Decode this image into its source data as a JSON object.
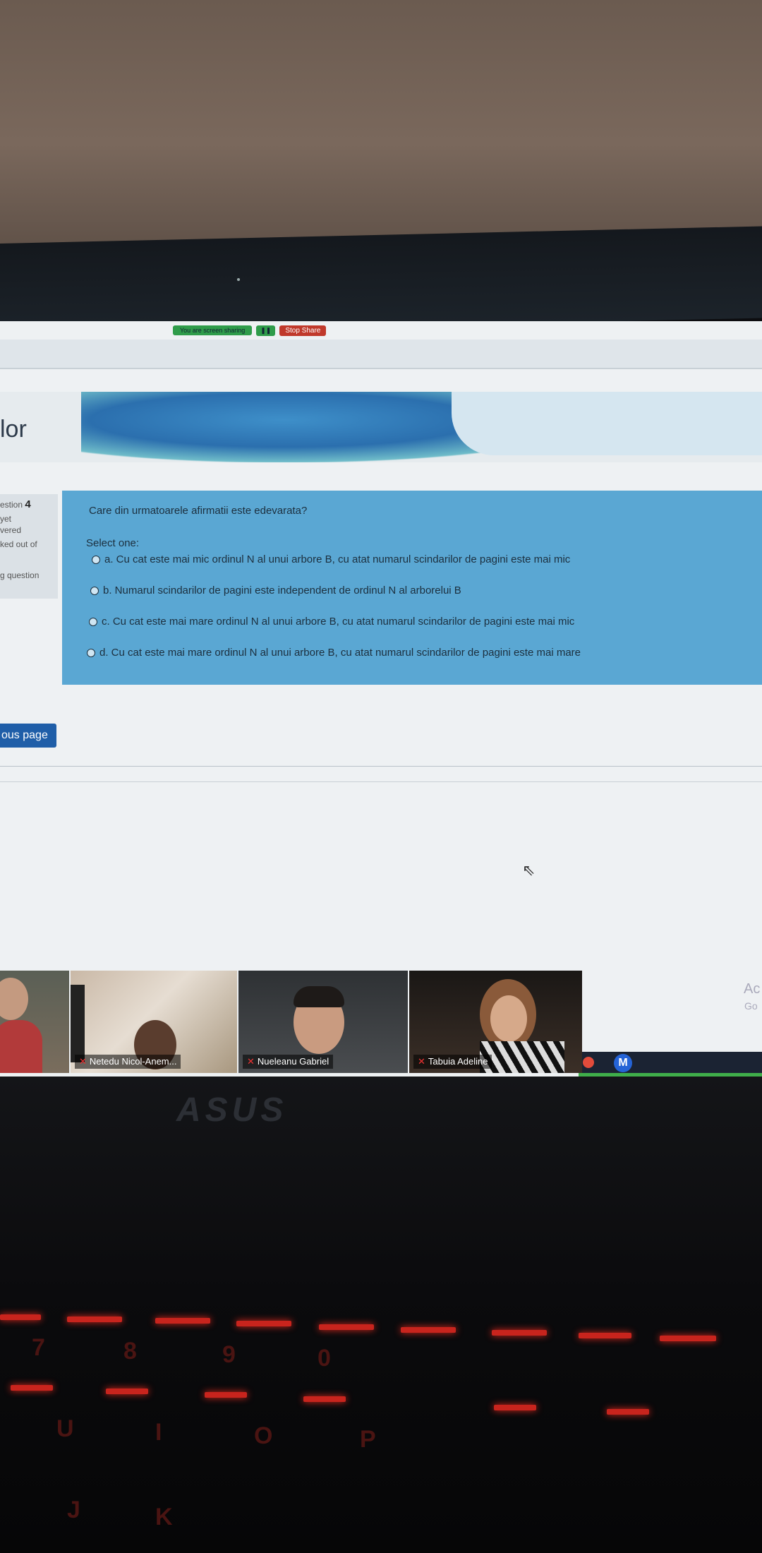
{
  "screen_share": {
    "status_text": "You are screen sharing",
    "stop_share_label": "Stop Share"
  },
  "site": {
    "title": "lor"
  },
  "question_nav": {
    "question_label": "estion",
    "question_number": "4",
    "status_line1": "yet",
    "status_line2": "vered",
    "marked_out_of": "ked out of",
    "flag_label": "g question"
  },
  "question": {
    "text": "Care din urmatoarele afirmatii este edevarata?",
    "select_prompt": "Select one:",
    "options": [
      "a. Cu cat este mai mic ordinul N al unui arbore B, cu atat numarul scindarilor de pagini este mai mic",
      "b. Numarul scindarilor de pagini este independent de ordinul N al arborelui B",
      "c. Cu cat este mai mare ordinul N al unui arbore B, cu atat numarul scindarilor de pagini este mai mic",
      "d. Cu cat este mai mare ordinul N al unui arbore B, cu atat numarul scindarilor de pagini este mai mare"
    ]
  },
  "navigation": {
    "previous_label": "ous page"
  },
  "windows_activation": {
    "line1": "Ac",
    "line2": "Go"
  },
  "taskbar": {
    "m_app_letter": "M"
  },
  "participants": [
    {
      "name": ""
    },
    {
      "name": "Netedu Nicol-Anem..."
    },
    {
      "name": "Nueleanu Gabriel"
    },
    {
      "name": "Tabuia Adeline"
    }
  ],
  "laptop": {
    "brand": "ASUS"
  },
  "keyboard": {
    "glyphs": [
      "7",
      "8",
      "9",
      "0",
      "U",
      "I",
      "O",
      "P",
      "J",
      "K"
    ]
  }
}
